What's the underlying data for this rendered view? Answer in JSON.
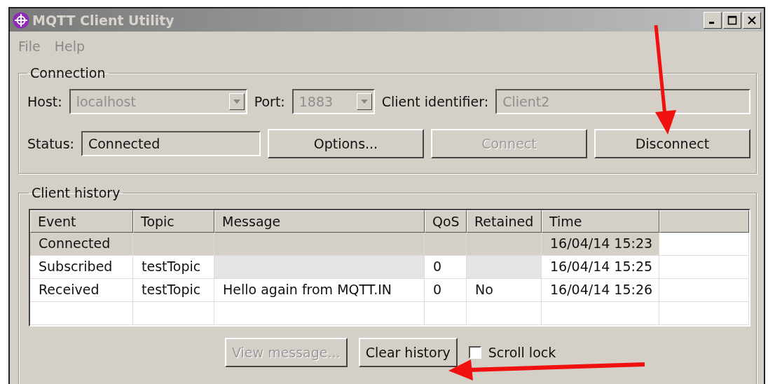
{
  "window": {
    "title": "MQTT Client Utility"
  },
  "menu": [
    {
      "label": "File"
    },
    {
      "label": "Help"
    }
  ],
  "connection": {
    "title": "Connection",
    "host": {
      "label": "Host:",
      "value": "localhost",
      "disabled": true
    },
    "port": {
      "label": "Port:",
      "value": "1883",
      "disabled": true
    },
    "client_id": {
      "label": "Client identifier:",
      "value": "Client2",
      "disabled": true
    },
    "status": {
      "label": "Status:",
      "value": "Connected"
    },
    "buttons": [
      {
        "label": "Options...",
        "disabled": false
      },
      {
        "label": "Connect",
        "disabled": true
      },
      {
        "label": "Disconnect",
        "disabled": false
      }
    ]
  },
  "history": {
    "title": "Client history",
    "columns": [
      "Event",
      "Topic",
      "Message",
      "QoS",
      "Retained",
      "Time"
    ],
    "rows": [
      {
        "cells": [
          "Connected",
          null,
          null,
          null,
          null,
          "16/04/14 15:23"
        ],
        "selected": true,
        "shaded": [
          false,
          false,
          false,
          false,
          false,
          false
        ]
      },
      {
        "cells": [
          "Subscribed",
          "testTopic",
          null,
          "0",
          null,
          "16/04/14 15:25"
        ],
        "selected": false,
        "shaded": [
          false,
          false,
          true,
          false,
          true,
          false
        ]
      },
      {
        "cells": [
          "Received",
          "testTopic",
          "Hello again from MQTT.IN",
          "0",
          "No",
          "16/04/14 15:26"
        ],
        "selected": false,
        "shaded": [
          false,
          false,
          false,
          false,
          false,
          false
        ]
      },
      {
        "cells": [
          null,
          null,
          null,
          null,
          null,
          null
        ],
        "selected": false,
        "shaded": [
          false,
          false,
          false,
          false,
          false,
          false
        ]
      }
    ],
    "buttons": [
      {
        "label": "View message...",
        "disabled": true
      },
      {
        "label": "Clear history",
        "disabled": false
      }
    ],
    "scroll_lock": {
      "label": "Scroll lock",
      "checked": false
    }
  }
}
